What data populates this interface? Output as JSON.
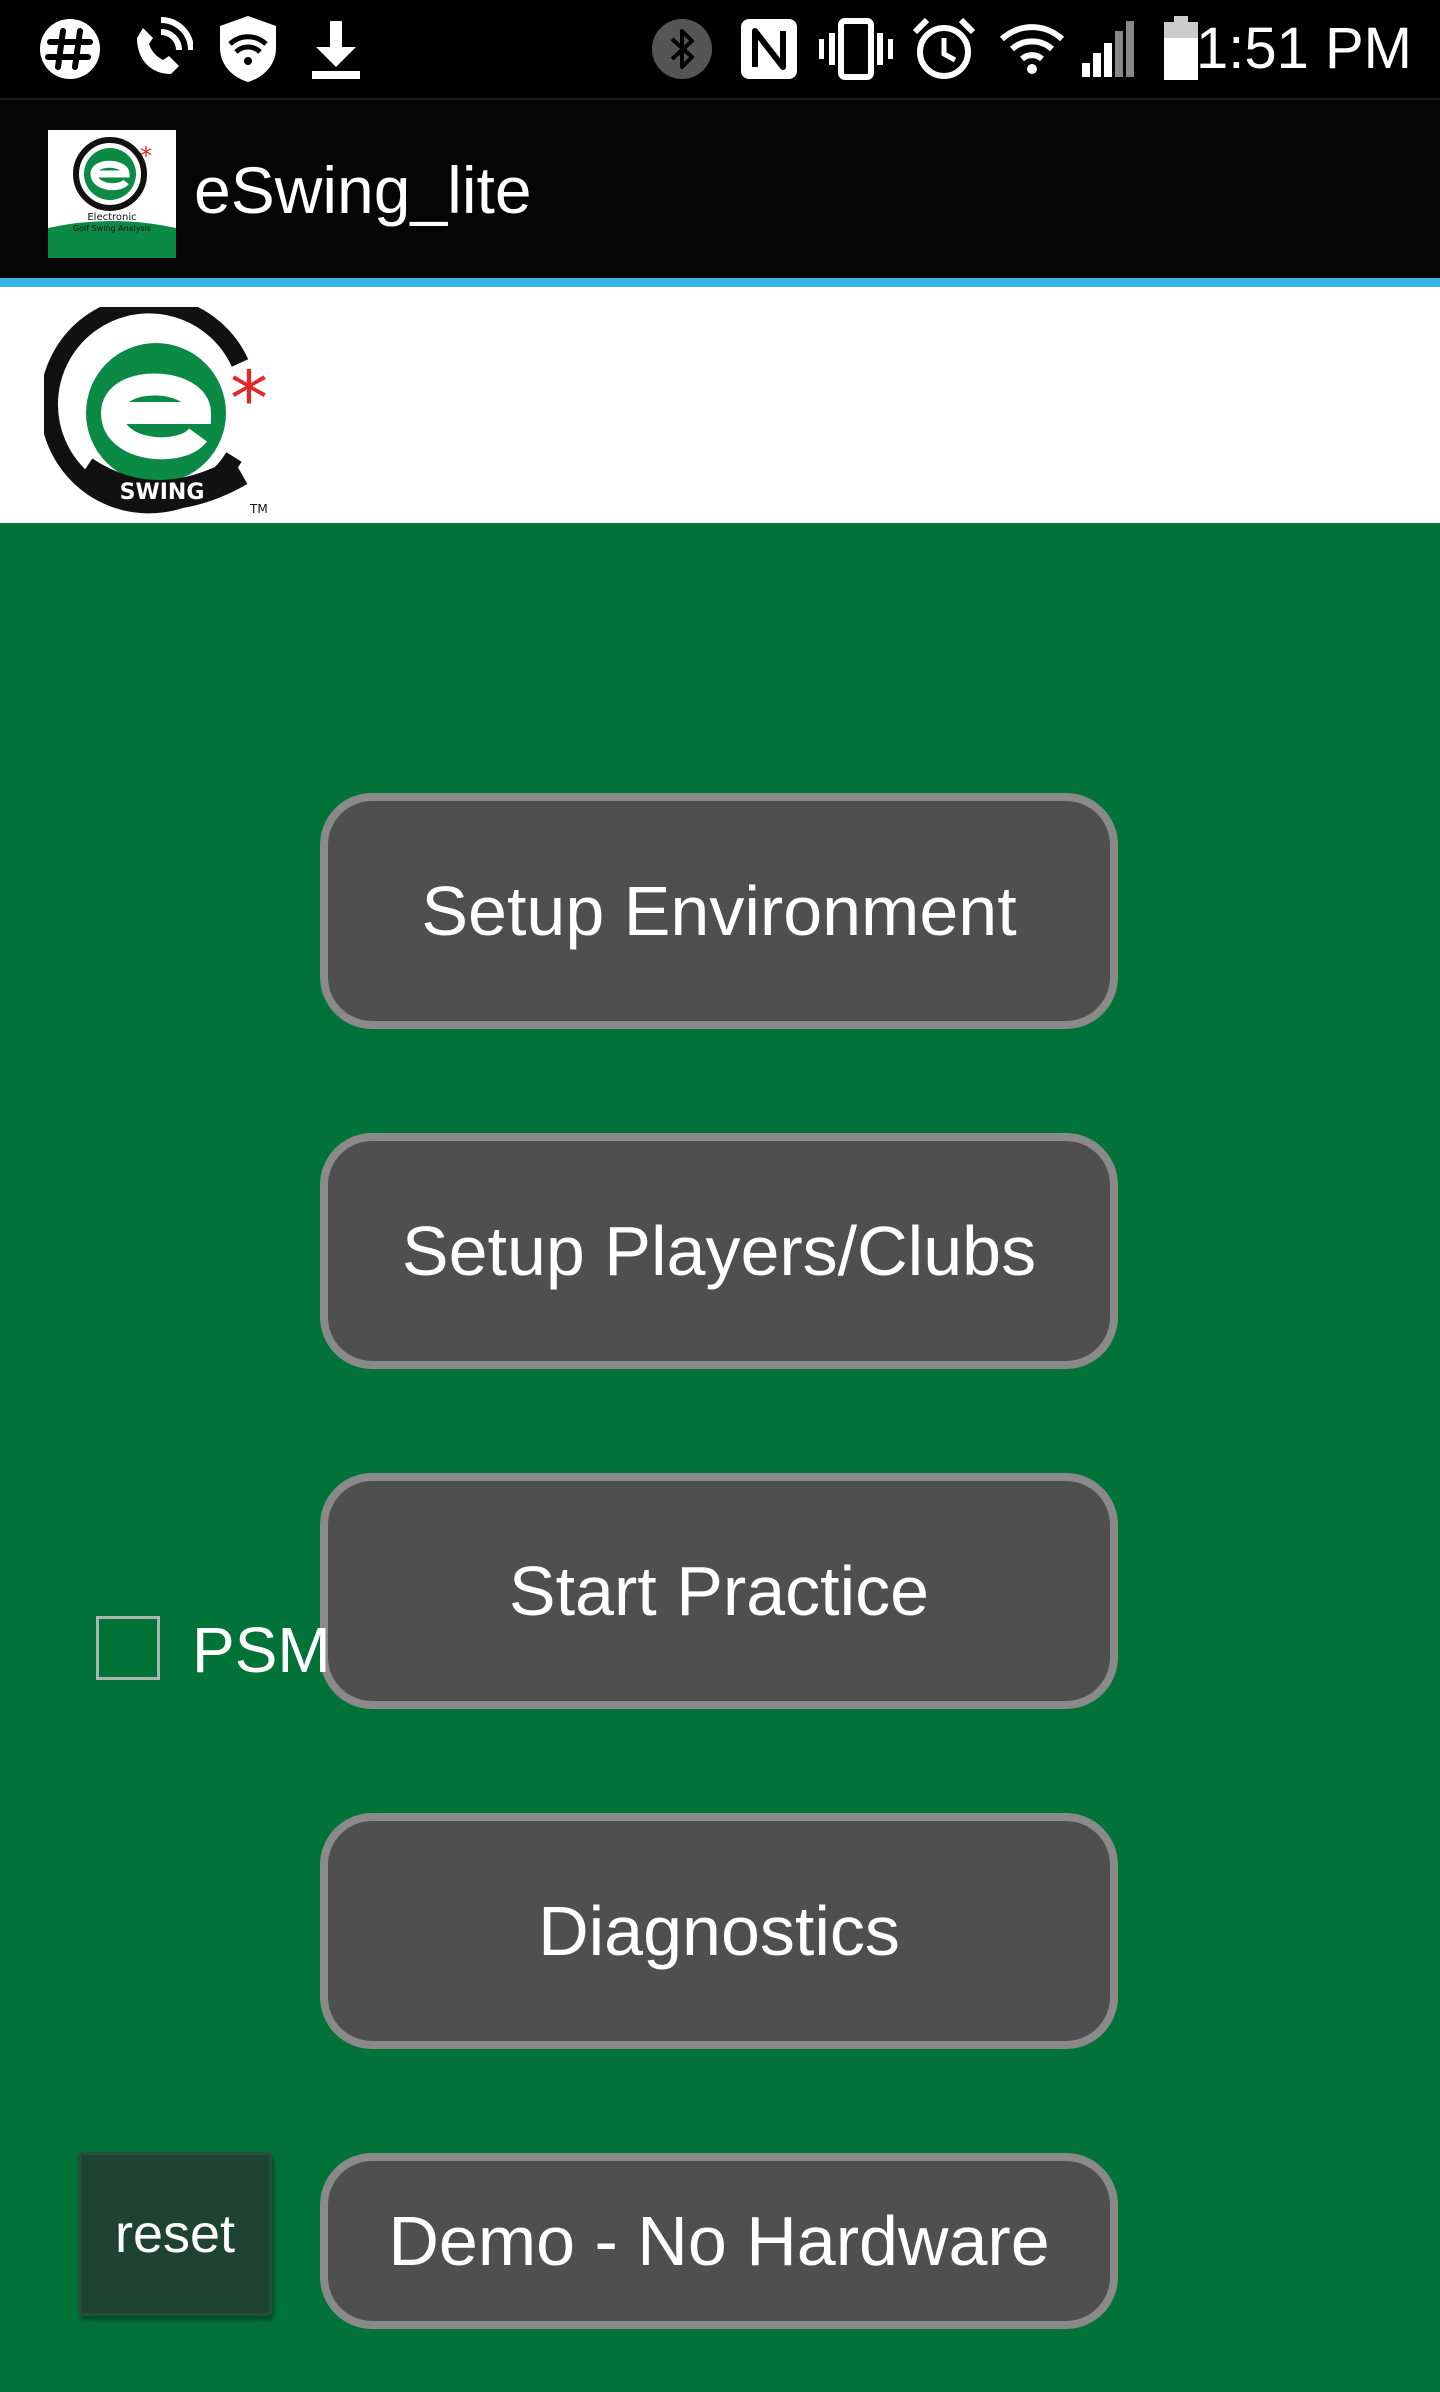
{
  "status_bar": {
    "time": "1:51 PM",
    "left_icons": [
      "slack-icon",
      "wifi-calling-icon",
      "shield-wifi-icon",
      "download-icon"
    ],
    "right_icons": [
      "bluetooth-icon",
      "nfc-icon",
      "vibrate-icon",
      "alarm-icon",
      "wifi-icon",
      "cell-signal-icon",
      "battery-icon"
    ]
  },
  "app_bar": {
    "title": "eSwing_lite",
    "icon": "eswing-app-icon",
    "icon_caption_line1": "Electronic",
    "icon_caption_line2": "Golf Swing Analysis"
  },
  "logo": {
    "name": "eswing-logo",
    "letter": "e",
    "star": "*",
    "arc_text": "SWING",
    "tm": "TM"
  },
  "buttons": {
    "setup_environment": "Setup Environment",
    "setup_players_clubs": "Setup Players/Clubs",
    "start_practice": "Start Practice",
    "diagnostics": "Diagnostics",
    "demo_no_hardware": "Demo - No Hardware",
    "reset": "reset"
  },
  "psm": {
    "label": "PSM",
    "checked": false
  },
  "colors": {
    "background_green": "#017339",
    "button_fill": "#4f4f4f",
    "button_border": "#8a8a8a",
    "appbar_accent": "#33b5e5",
    "logo_green": "#0a8a44",
    "logo_red": "#e5262a",
    "reset_fill": "#1e4233"
  }
}
